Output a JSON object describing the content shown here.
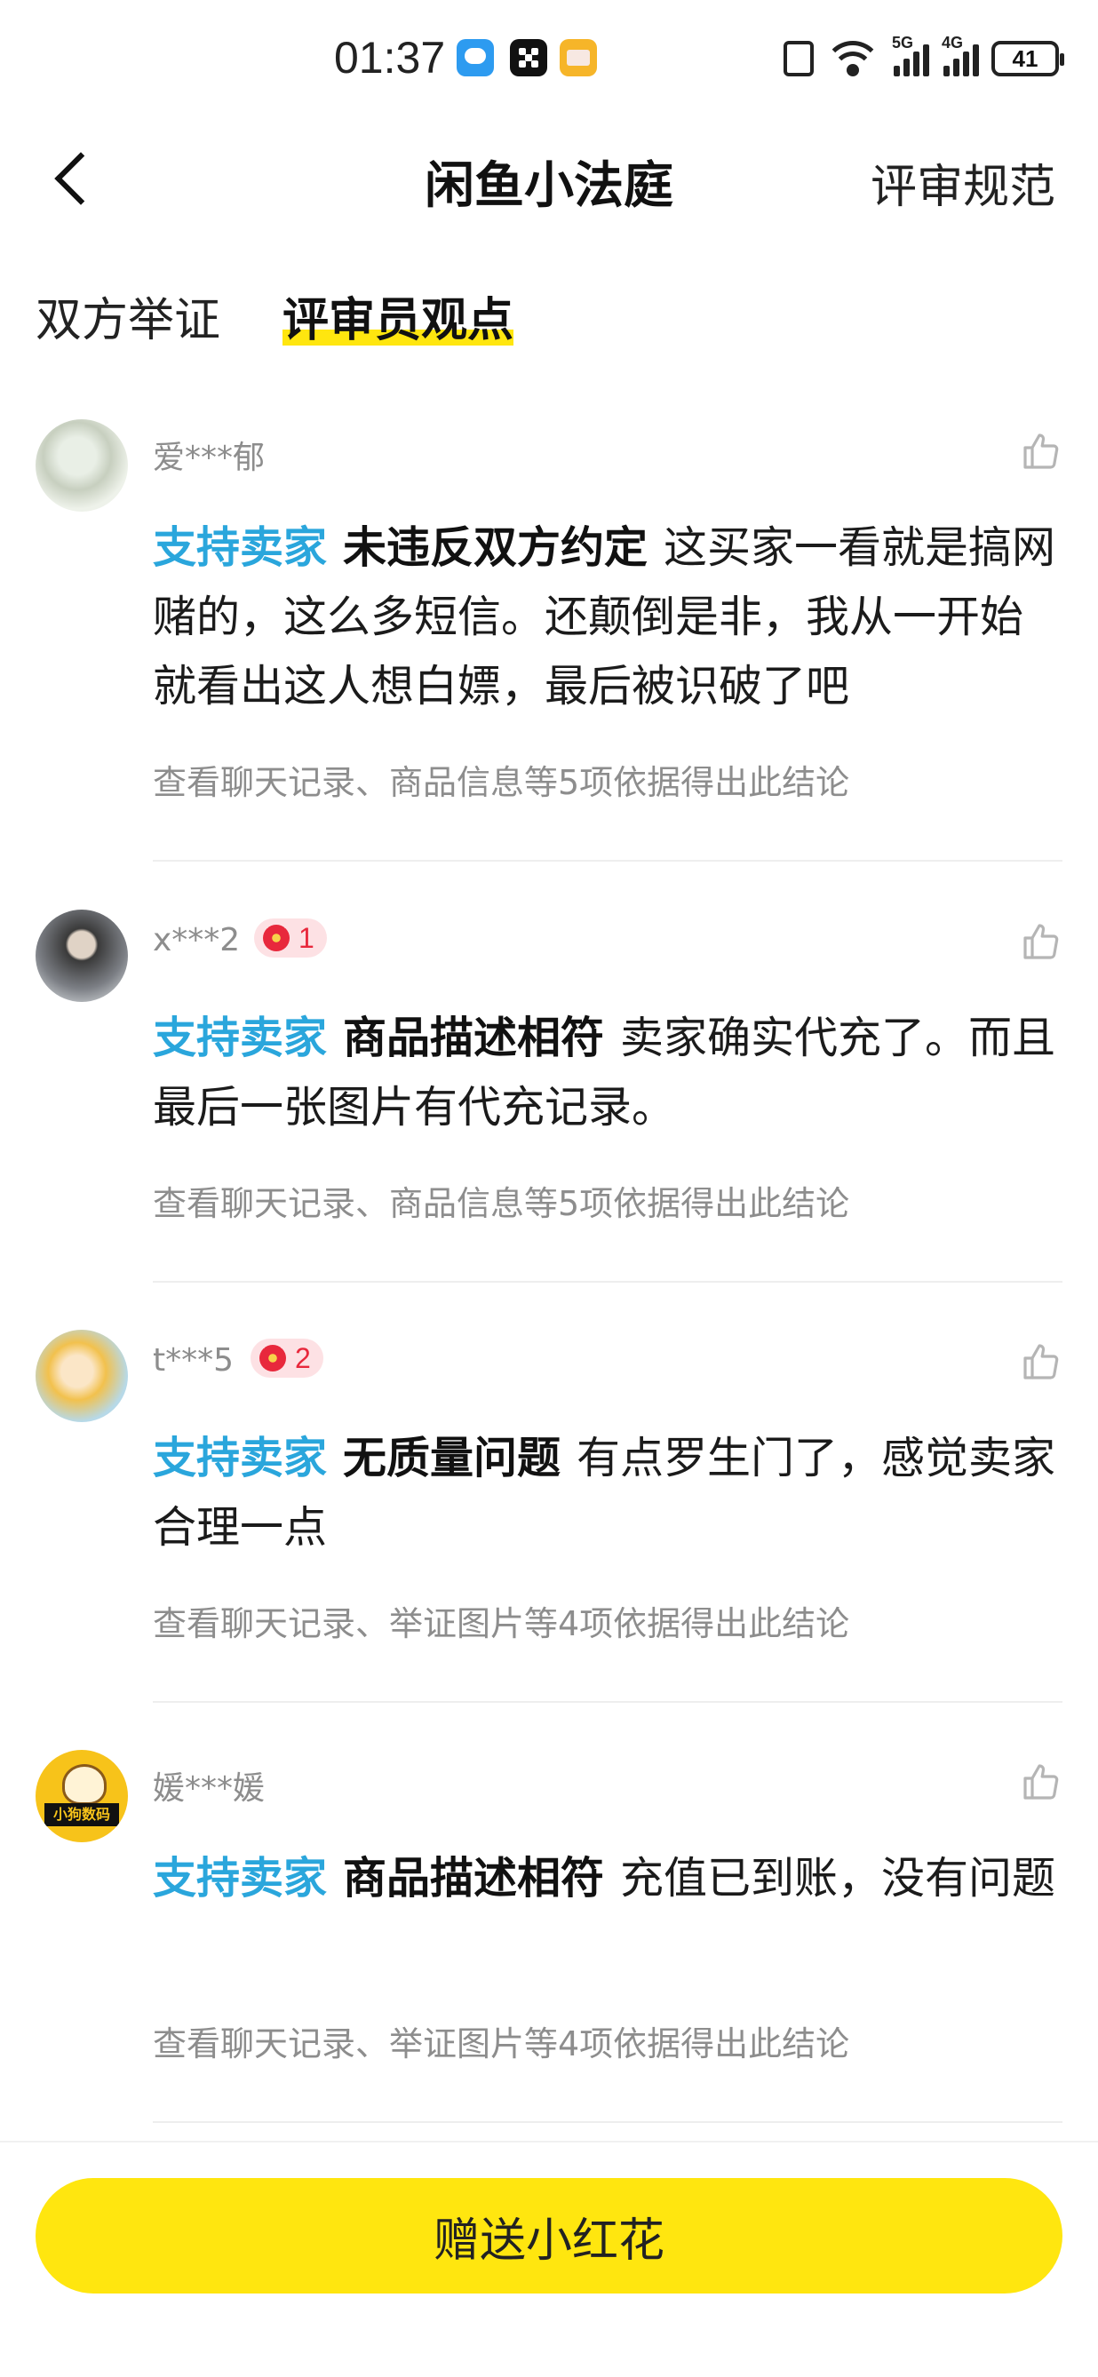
{
  "status_bar": {
    "time": "01:37",
    "network_a": "5G",
    "network_b": "4G",
    "wifi_level": "6",
    "battery": "41"
  },
  "nav": {
    "title": "闲鱼小法庭",
    "rules": "评审规范"
  },
  "tabs": [
    {
      "label": "双方举证",
      "active": false
    },
    {
      "label": "评审员观点",
      "active": true
    }
  ],
  "comments": [
    {
      "user": "爱***郁",
      "flowers": "",
      "stance": "支持卖家",
      "claim": "未违反双方约定",
      "text": "这买家一看就是搞网赌的，这么多短信。还颠倒是非，我从一开始就看出这人想白嫖，最后被识破了吧",
      "basis": "查看聊天记录、商品信息等5项依据得出此结论"
    },
    {
      "user": "x***2",
      "flowers": "1",
      "stance": "支持卖家",
      "claim": "商品描述相符",
      "text": "卖家确实代充了。而且最后一张图片有代充记录。",
      "basis": "查看聊天记录、商品信息等5项依据得出此结论"
    },
    {
      "user": "t***5",
      "flowers": "2",
      "stance": "支持卖家",
      "claim": "无质量问题",
      "text": "有点罗生门了，感觉卖家合理一点",
      "basis": "查看聊天记录、举证图片等4项依据得出此结论"
    },
    {
      "user": "媛***媛",
      "flowers": "",
      "stance": "支持卖家",
      "claim": "商品描述相符",
      "text": "充值已到账，没有问题",
      "basis": "查看聊天记录、举证图片等4项依据得出此结论"
    }
  ],
  "bottom": {
    "gift_button": "赠送小红花"
  },
  "colors": {
    "accent_yellow": "#ffe60f",
    "stance_blue": "#2aa6dc",
    "flower_red": "#e8283c"
  }
}
